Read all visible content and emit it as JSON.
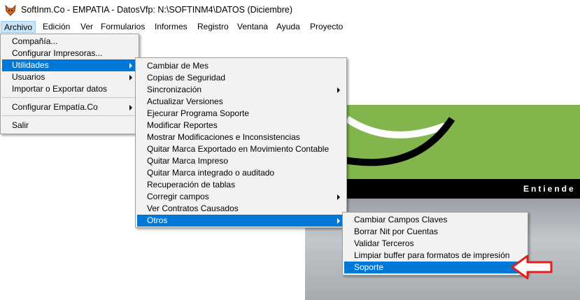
{
  "window": {
    "title": "SoftInm.Co - EMPATIA - DatosVfp: N:\\SOFTINM4\\DATOS  (Diciembre)",
    "icon": "fox-icon"
  },
  "menubar": [
    "Archivo",
    "Edición",
    "Ver",
    "Formularios",
    "Informes",
    "Registro",
    "Ventana",
    "Ayuda",
    "Proyecto"
  ],
  "archivo_menu": [
    "Compañía...",
    "Configurar Impresoras...",
    "Utilidades",
    "Usuarios",
    "Importar o Exportar datos",
    "Configurar Empatía.Co",
    "Salir"
  ],
  "utilidades_menu": [
    "Cambiar de Mes",
    "Copias de Seguridad",
    "Sincronización",
    "Actualizar Versiones",
    "Ejecurar Programa Soporte",
    "Modificar Reportes",
    "Mostrar Modificaciones e Inconsistencias",
    "Quitar Marca Exportado en Movimiento Contable",
    "Quitar Marca Impreso",
    "Quitar Marca integrado o auditado",
    "Recuperación de tablas",
    "Corregir campos",
    "Ver Contratos Causados",
    "Otros"
  ],
  "otros_menu": [
    "Cambiar Campos Claves",
    "Borrar Nit por Cuentas",
    "Validar Terceros",
    "Limpiar buffer para formatos de impresión",
    "Soporte"
  ],
  "background_banner_text": "Entiende",
  "colors": {
    "highlight": "#0078d7",
    "menu_bg": "#f2f2f2",
    "banner_green": "#82b54b",
    "pointer_arrow": "#e0201c"
  }
}
